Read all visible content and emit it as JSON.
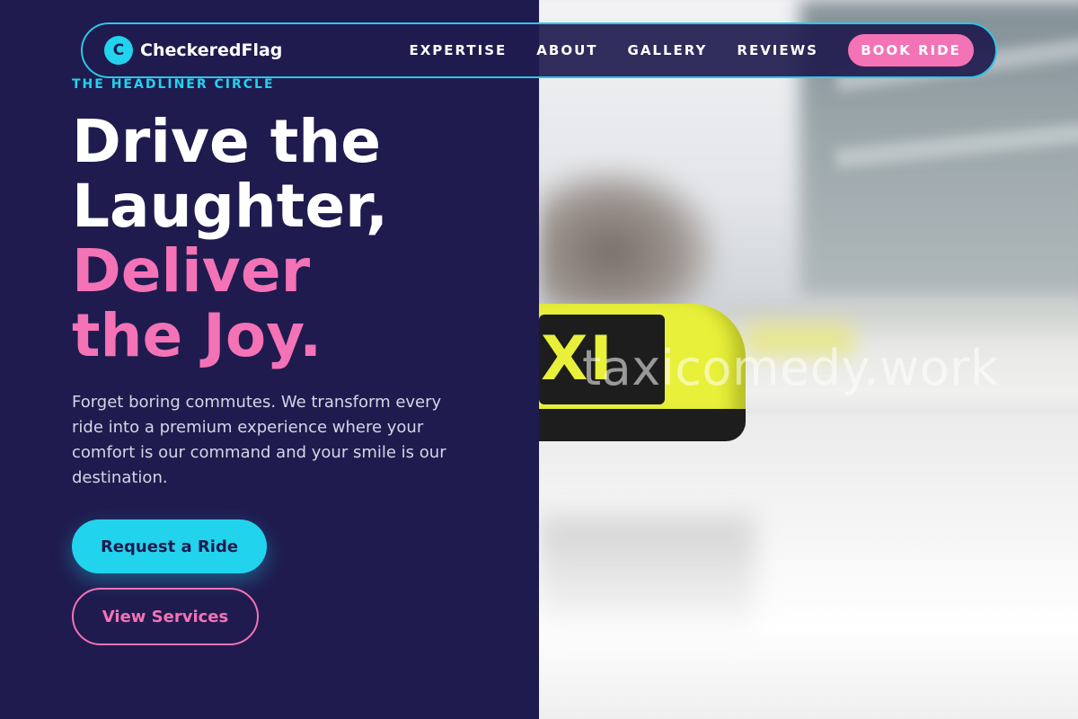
{
  "brand": {
    "logo_letter": "C",
    "name": "CheckeredFlag"
  },
  "nav": {
    "links": [
      "EXPERTISE",
      "ABOUT",
      "GALLERY",
      "REVIEWS"
    ],
    "cta": "BOOK RIDE"
  },
  "hero": {
    "eyebrow": "THE HEADLINER CIRCLE",
    "headline_line1": "Drive the",
    "headline_line2": "Laughter,",
    "headline_line3": "Deliver",
    "headline_line4": "the Joy.",
    "lead": "Forget boring commutes. We transform every ride into a premium experience where your comfort is our command and your smile is our destination.",
    "primary_button": "Request a Ride",
    "secondary_button": "View Services"
  },
  "image": {
    "sign_text": "XI",
    "watermark": "taxicomedy.work"
  },
  "colors": {
    "background": "#1f1b4e",
    "accent_cyan": "#22d3ee",
    "accent_pink": "#f472b6",
    "text_white": "#ffffff"
  }
}
